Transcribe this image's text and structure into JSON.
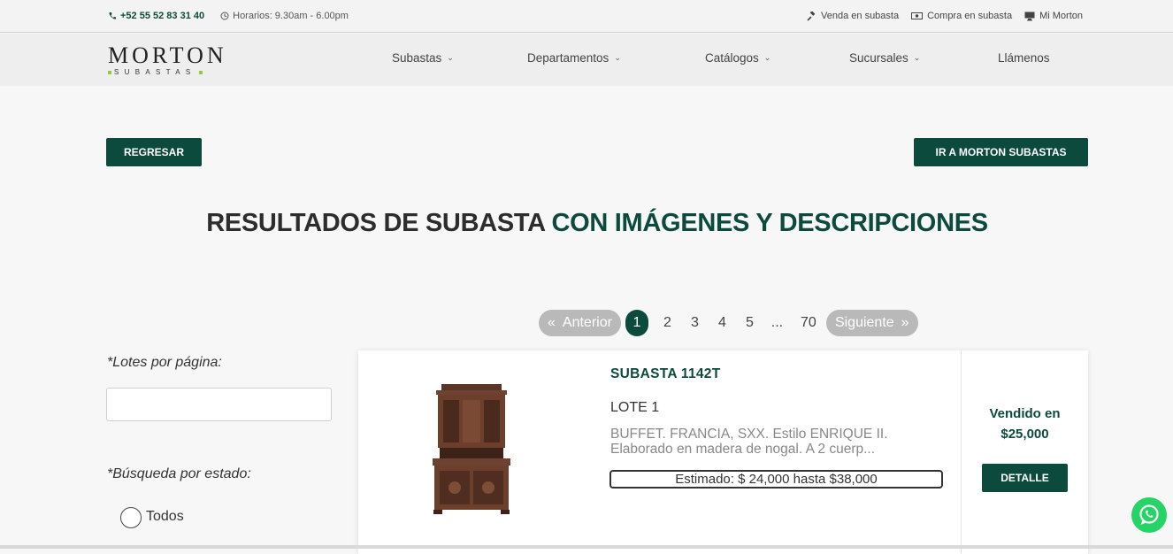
{
  "topbar": {
    "phone": "+52 55 52 83 31 40",
    "hours": "Horarios: 9.30am - 6.00pm",
    "links": [
      {
        "label": "Venda en subasta",
        "icon": "gavel-icon"
      },
      {
        "label": "Compra en subasta",
        "icon": "money-icon"
      },
      {
        "label": "Mi Morton",
        "icon": "monitor-icon"
      }
    ]
  },
  "logo": {
    "main": "MORTON",
    "sub": "SUBASTAS"
  },
  "nav": [
    {
      "label": "Subastas"
    },
    {
      "label": "Departamentos"
    },
    {
      "label": "Catálogos"
    },
    {
      "label": "Sucursales"
    },
    {
      "label": "Llámenos"
    }
  ],
  "buttons": {
    "back": "REGRESAR",
    "goto": "IR A MORTON SUBASTAS"
  },
  "title": {
    "dark": "RESULTADOS DE SUBASTA",
    "accent": "CON IMÁGENES Y DESCRIPCIONES"
  },
  "pagination": {
    "prev_symbol": "«",
    "prev": "Anterior",
    "pages": [
      "2",
      "3",
      "4",
      "5",
      "...",
      "70"
    ],
    "current": "1",
    "next": "Siguiente",
    "next_symbol": "»"
  },
  "filters": {
    "per_page_label": "*Lotes por página:",
    "per_page_value": "",
    "state_label": "*Búsqueda por estado:",
    "state_option": "Todos"
  },
  "lot": {
    "auction": "SUBASTA 1142T",
    "lot": "LOTE 1",
    "description": "BUFFET. FRANCIA, SXX. Estilo ENRIQUE II. Elaborado en madera de nogal. A 2 cuerp...",
    "estimate": "Estimado: $ 24,000 hasta $38,000",
    "sold_label": "Vendido en",
    "sold_price": "$25,000",
    "detail_button": "DETALLE"
  },
  "colors": {
    "brand": "#0c4a3d",
    "logo_dot": "#9bc53d",
    "whatsapp": "#25d366"
  }
}
